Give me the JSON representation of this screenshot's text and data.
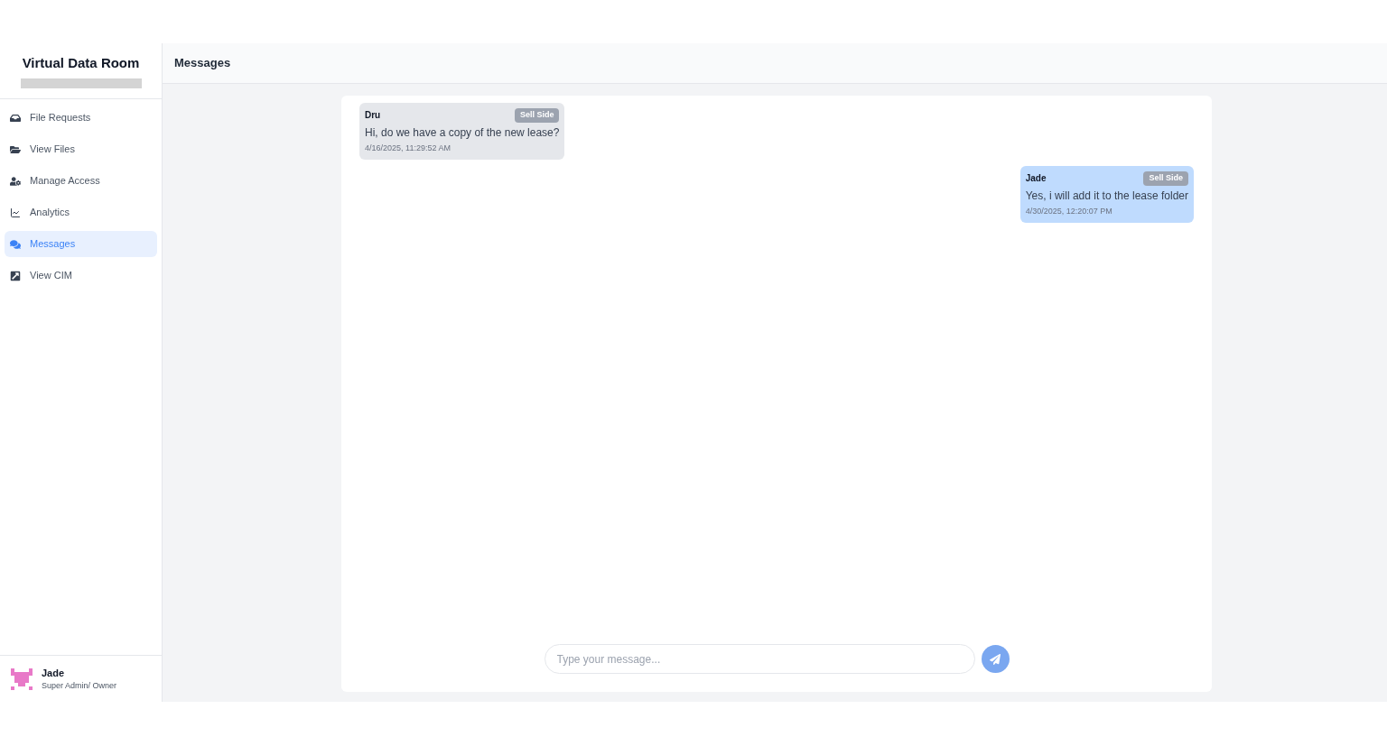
{
  "sidebar": {
    "title": "Virtual Data Room",
    "items": [
      {
        "label": "File Requests",
        "selected": false
      },
      {
        "label": "View Files",
        "selected": false
      },
      {
        "label": "Manage Access",
        "selected": false
      },
      {
        "label": "Analytics",
        "selected": false
      },
      {
        "label": "Messages",
        "selected": true
      },
      {
        "label": "View CIM",
        "selected": false
      }
    ],
    "user": {
      "name": "Jade",
      "role": "Super Admin/ Owner"
    }
  },
  "header": {
    "title": "Messages"
  },
  "messages": [
    {
      "kind": "incoming",
      "sender": "Dru",
      "tag": "Sell Side",
      "text": "Hi, do we have a copy of the new lease?",
      "time": "4/16/2025, 11:29:52 AM"
    },
    {
      "kind": "outgoing",
      "sender": "Jade",
      "tag": "Sell Side",
      "text": "Yes, i will add it to the lease folder",
      "time": "4/30/2025, 12:20:07 PM"
    }
  ],
  "composer": {
    "placeholder": "Type your message..."
  }
}
